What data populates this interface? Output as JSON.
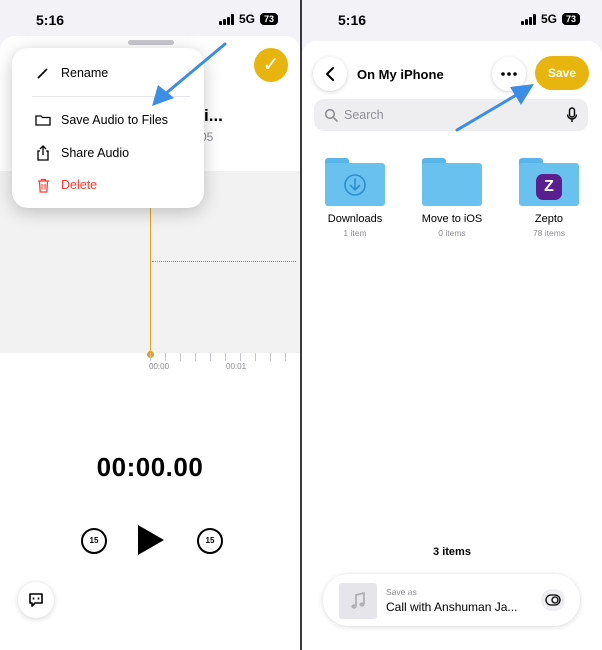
{
  "left": {
    "status": {
      "time": "5:16",
      "network": "5G",
      "battery": "73"
    },
    "menu": {
      "items": [
        {
          "label": "Rename",
          "icon": "pencil-icon"
        },
        {
          "label": "Save Audio to Files",
          "icon": "folder-icon"
        },
        {
          "label": "Share Audio",
          "icon": "share-icon"
        },
        {
          "label": "Delete",
          "icon": "trash-icon"
        }
      ]
    },
    "recording": {
      "title_fragment": "n Jai...",
      "date_fragment": "05"
    },
    "waveform": {
      "tick_labels": [
        "00:00",
        "00:01"
      ]
    },
    "player": {
      "timer": "00:00.00",
      "skip_back": "15",
      "skip_forward": "15"
    },
    "colors": {
      "accent": "#e8b40e",
      "destructive": "#ff3b30",
      "playhead": "#e0a020"
    }
  },
  "right": {
    "status": {
      "time": "5:16",
      "network": "5G",
      "battery": "73"
    },
    "header": {
      "title": "On My iPhone",
      "save_label": "Save"
    },
    "search": {
      "placeholder": "Search"
    },
    "folders": [
      {
        "name": "Downloads",
        "count": "1 item"
      },
      {
        "name": "Move to iOS",
        "count": "0 items"
      },
      {
        "name": "Zepto",
        "count": "78 items",
        "badge": "Z"
      }
    ],
    "items_count": "3 items",
    "save_as": {
      "label": "Save as",
      "name": "Call with Anshuman Ja..."
    },
    "colors": {
      "accent": "#e8b40e",
      "folder": "#69c1f0",
      "arrow": "#3a8ee6"
    }
  }
}
